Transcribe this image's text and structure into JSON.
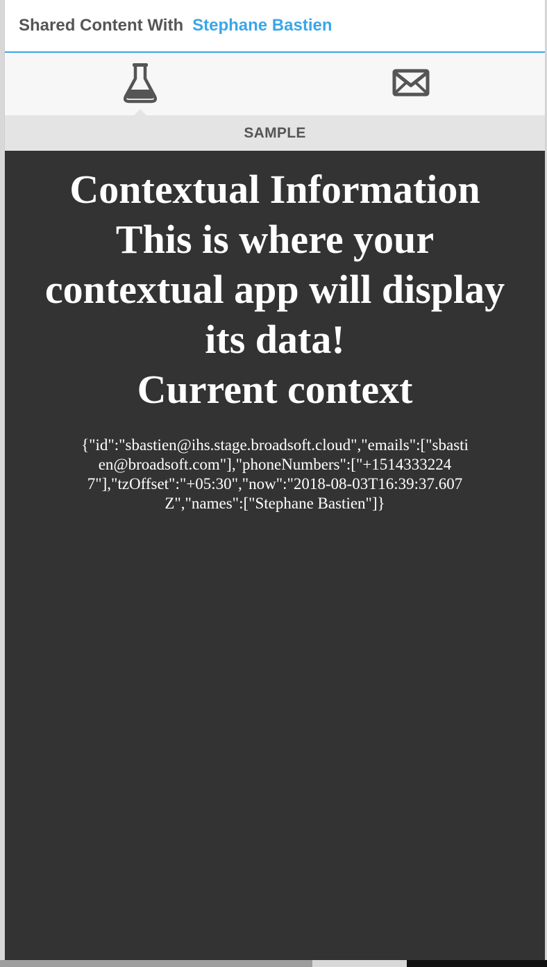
{
  "header": {
    "label": "Shared Content With",
    "name": "Stephane Bastien"
  },
  "tabs": [
    {
      "icon": "flask-icon",
      "active": true
    },
    {
      "icon": "envelope-icon",
      "active": false
    }
  ],
  "section": {
    "title": "SAMPLE"
  },
  "content": {
    "heading_lines": [
      "Contextual Information",
      "This is where your",
      "contextual app will display",
      "its data!",
      "Current context"
    ],
    "context_json": "{\"id\":\"sbastien@ihs.stage.broadsoft.cloud\",\"emails\":[\"sbastien@broadsoft.com\"],\"phoneNumbers\":[\"+15143332247\"],\"tzOffset\":\"+05:30\",\"now\":\"2018-08-03T16:39:37.607Z\",\"names\":[\"Stephane Bastien\"]}"
  },
  "colors": {
    "accent": "#3aa6e8",
    "content_bg": "#333333",
    "icon": "#555555"
  }
}
